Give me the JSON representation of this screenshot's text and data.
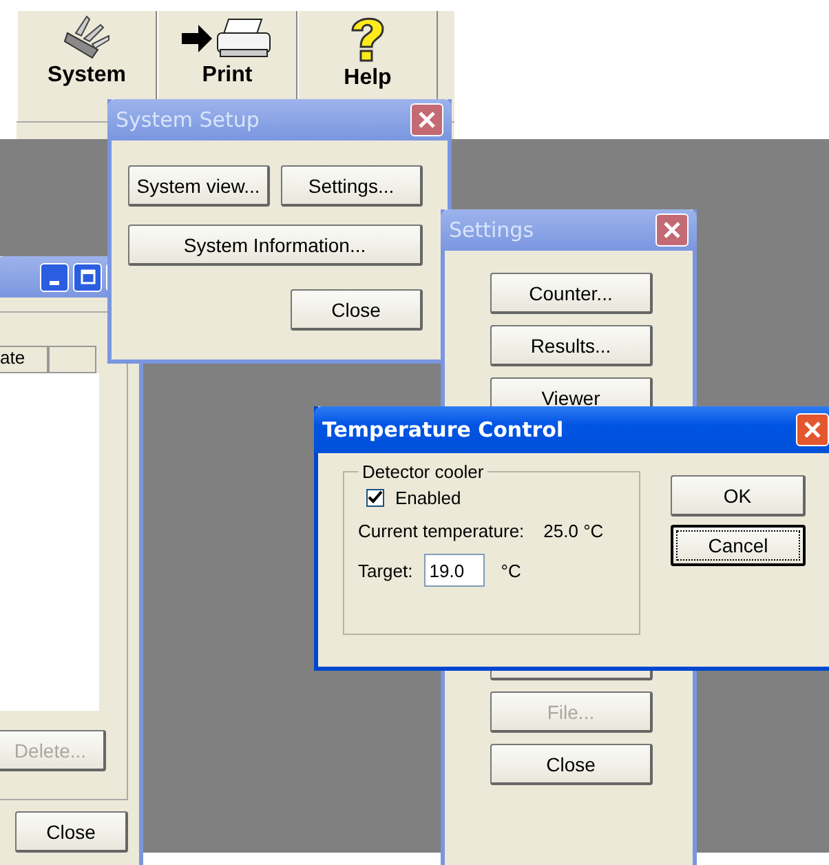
{
  "toolbar": {
    "buttons": [
      {
        "label": "System",
        "kind": "system"
      },
      {
        "label": "Print",
        "kind": "print"
      },
      {
        "label": "Help",
        "kind": "help"
      }
    ]
  },
  "background_window": {
    "column_header": "ate",
    "buttons": [
      {
        "label": "Delete...",
        "disabled": true
      },
      {
        "label": "Close",
        "disabled": false
      }
    ]
  },
  "system_setup": {
    "title": "System Setup",
    "active": false,
    "buttons": [
      {
        "label": "System view...",
        "kind": "half"
      },
      {
        "label": "Settings...",
        "kind": "half"
      },
      {
        "label": "System Information...",
        "kind": "full"
      },
      {
        "label": "Close",
        "kind": "right"
      }
    ]
  },
  "settings": {
    "title": "Settings",
    "active": false,
    "buttons": [
      {
        "label": "Counter...",
        "disabled": false
      },
      {
        "label": "Results...",
        "disabled": false
      },
      {
        "label": "Viewer",
        "disabled": false
      },
      {
        "label": "File...",
        "disabled": true
      },
      {
        "label": "Close",
        "disabled": false
      }
    ]
  },
  "temperature_control": {
    "title": "Temperature Control",
    "active": true,
    "group": {
      "title": "Detector cooler",
      "checkbox": {
        "label": "Enabled",
        "checked": true
      },
      "current_label": "Current temperature:",
      "current_value": "25.0 °C",
      "target_label": "Target:",
      "target_value": "19.0",
      "target_unit": "°C"
    },
    "buttons": [
      {
        "label": "OK",
        "focused": false
      },
      {
        "label": "Cancel",
        "focused": true
      }
    ]
  }
}
